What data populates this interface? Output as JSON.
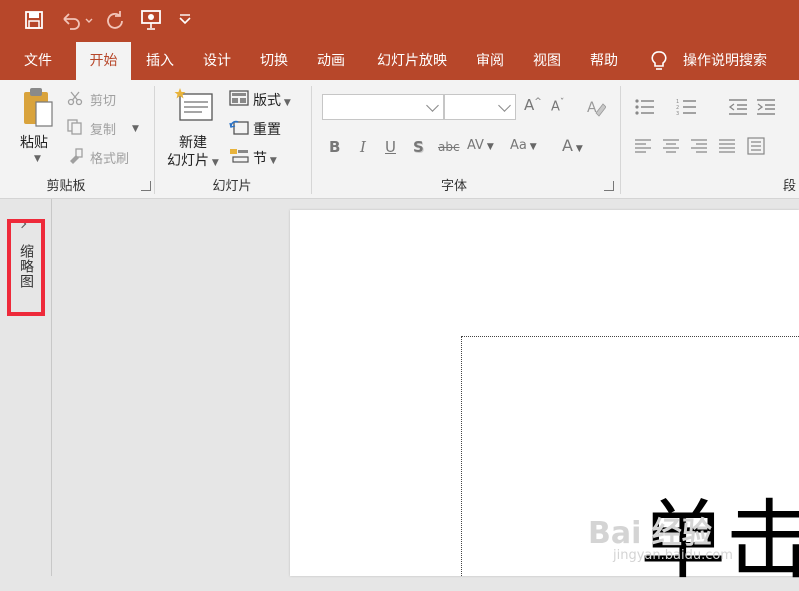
{
  "quick_access": {
    "save": "save-icon",
    "undo": "undo-icon",
    "redo": "redo-icon",
    "present": "present-icon",
    "customize": "customize-icon"
  },
  "tabs": [
    {
      "label": "文件"
    },
    {
      "label": "开始"
    },
    {
      "label": "插入"
    },
    {
      "label": "设计"
    },
    {
      "label": "切换"
    },
    {
      "label": "动画"
    },
    {
      "label": "幻灯片放映"
    },
    {
      "label": "审阅"
    },
    {
      "label": "视图"
    },
    {
      "label": "帮助"
    }
  ],
  "active_tab": "开始",
  "search": {
    "label": "操作说明搜索",
    "icon": "lightbulb-icon"
  },
  "ribbon": {
    "clipboard": {
      "paste": "粘贴",
      "cut": "剪切",
      "copy": "复制",
      "format_painter": "格式刷",
      "group_label": "剪贴板"
    },
    "slides": {
      "new_slide_line1": "新建",
      "new_slide_line2": "幻灯片",
      "layout": "版式",
      "reset": "重置",
      "section": "节",
      "group_label": "幻灯片"
    },
    "font": {
      "group_label": "字体",
      "font_name": "",
      "font_size": "",
      "bold": "B",
      "italic": "I",
      "underline": "U",
      "shadow": "S",
      "strikethrough": "abc",
      "spacing": "AV",
      "change_case": "Aa",
      "font_color": "A"
    },
    "paragraph": {
      "group_label": "段"
    }
  },
  "left_pane": {
    "collapsed_label": "缩略图"
  },
  "slide": {
    "title_partial": "单击"
  },
  "watermark": {
    "text": "Bai 经验",
    "sub": "jingyan.baidu.com"
  },
  "colors": {
    "accent": "#b7472a",
    "highlight": "#ee2a3a"
  }
}
